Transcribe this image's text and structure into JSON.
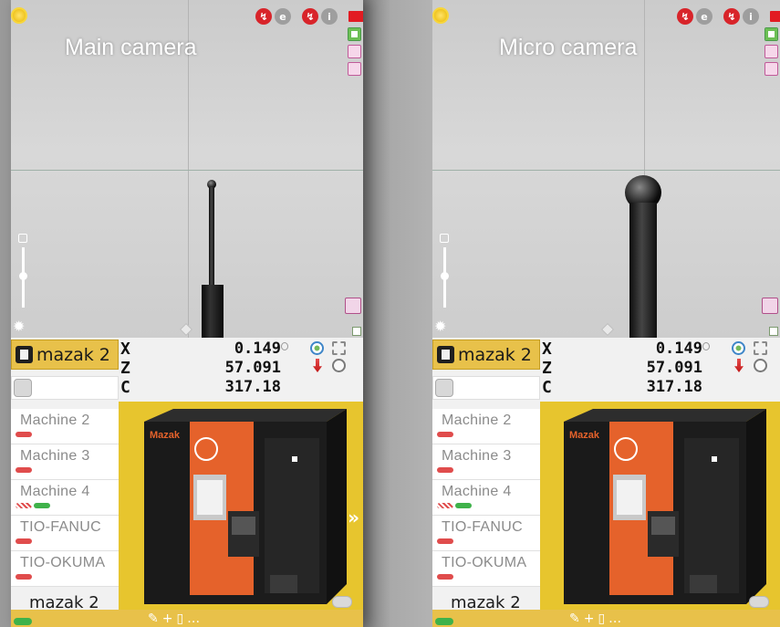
{
  "panels": [
    {
      "caption": "Main camera",
      "machine": "mazak 2",
      "coords": [
        {
          "axis": "X",
          "value": "0.149"
        },
        {
          "axis": "Z",
          "value": "57.091"
        },
        {
          "axis": "C",
          "value": "317.18"
        }
      ],
      "machines": [
        {
          "name": "Machine 2",
          "badges": [
            "red"
          ]
        },
        {
          "name": "Machine 3",
          "badges": [
            "red"
          ]
        },
        {
          "name": "Machine 4",
          "badges": [
            "hatch",
            "green"
          ]
        },
        {
          "name": "TIO-FANUC",
          "badges": [
            "red"
          ]
        },
        {
          "name": "TIO-OKUMA",
          "badges": [
            "red"
          ]
        }
      ],
      "footer_name": "mazak 2"
    },
    {
      "caption": "Micro camera",
      "machine": "mazak 2",
      "coords": [
        {
          "axis": "X",
          "value": "0.149"
        },
        {
          "axis": "Z",
          "value": "57.091"
        },
        {
          "axis": "C",
          "value": "317.18"
        }
      ],
      "machines": [
        {
          "name": "Machine 2",
          "badges": [
            "red"
          ]
        },
        {
          "name": "Machine 3",
          "badges": [
            "red"
          ]
        },
        {
          "name": "Machine 4",
          "badges": [
            "hatch",
            "green"
          ]
        },
        {
          "name": "TIO-FANUC",
          "badges": [
            "red"
          ]
        },
        {
          "name": "TIO-OKUMA",
          "badges": [
            "red"
          ]
        }
      ],
      "footer_name": "mazak 2"
    }
  ],
  "machine_image": {
    "brand": "Mazak"
  },
  "icons": {
    "status": [
      "probe-red-icon",
      "probe-refresh-icon",
      "probe-red-icon",
      "probe-grey-icon",
      "stop-flag-icon"
    ],
    "side": [
      "screen-icon",
      "layers-icon",
      "print-icon"
    ],
    "coord_tools": [
      "target-icon",
      "crop-icon",
      "arrow-down-icon",
      "search-icon"
    ]
  },
  "colors": {
    "accent_yellow": "#e8c14a",
    "machine_orange": "#e5622b",
    "status_red": "#d8242a",
    "ok_green": "#3fb24a"
  }
}
